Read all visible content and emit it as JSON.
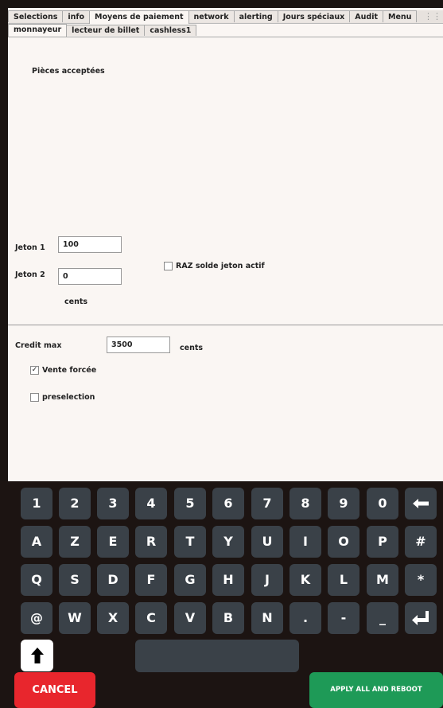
{
  "tabs": [
    "Selections",
    "info",
    "Moyens de paiement",
    "network",
    "alerting",
    "Jours spéciaux",
    "Audit",
    "Menu"
  ],
  "active_tab": "Moyens de paiement",
  "subtabs": [
    "monnayeur",
    "lecteur de billet",
    "cashless1"
  ],
  "active_subtab": "monnayeur",
  "form": {
    "pieces_label": "Pièces acceptées",
    "jeton1_label": "Jeton 1",
    "jeton1_value": "100",
    "jeton2_label": "Jeton 2",
    "jeton2_value": "0",
    "raz_label": "RAZ solde jeton actif",
    "raz_checked": false,
    "cents_label": "cents",
    "credit_label": "Credit max",
    "credit_value": "3500",
    "credit_unit": "cents",
    "vente_label": "Vente forcée",
    "vente_checked": true,
    "preselection_label": "preselection",
    "preselection_checked": false
  },
  "keyboard": {
    "row1": [
      "1",
      "2",
      "3",
      "4",
      "5",
      "6",
      "7",
      "8",
      "9",
      "0"
    ],
    "row2": [
      "A",
      "Z",
      "E",
      "R",
      "T",
      "Y",
      "U",
      "I",
      "O",
      "P",
      "#"
    ],
    "row3": [
      "Q",
      "S",
      "D",
      "F",
      "G",
      "H",
      "J",
      "K",
      "L",
      "M",
      "*"
    ],
    "row4": [
      "@",
      "W",
      "X",
      "C",
      "V",
      "B",
      "N",
      ".",
      "-",
      "_"
    ],
    "backspace_icon": "backspace-arrow-icon",
    "enter_icon": "enter-icon",
    "shift_icon": "shift-arrow-icon"
  },
  "buttons": {
    "cancel": "CANCEL",
    "apply": "APPLY ALL AND REBOOT"
  },
  "colors": {
    "cancel": "#e8262d",
    "apply": "#1e9a57",
    "key": "#3a4148"
  }
}
